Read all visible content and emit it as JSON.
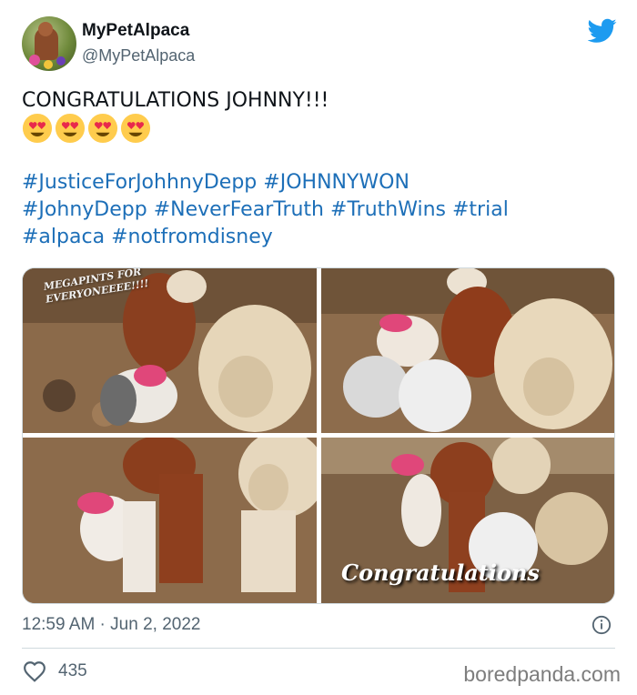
{
  "user": {
    "display_name": "MyPetAlpaca",
    "handle": "@MyPetAlpaca"
  },
  "tweet": {
    "text": "CONGRATULATIONS JOHNNY!!!",
    "emoji_count": 4,
    "hashtags": [
      "#JusticeForJohhnyDepp",
      "#JOHNNYWON",
      "#JohnyDepp",
      "#NeverFearTruth",
      "#TruthWins",
      "#trial",
      "#alpaca",
      "#notfromdisney"
    ],
    "photos": [
      {
        "caption": "MEGAPINTS FOR EVERYONEEEE!!!!"
      },
      {
        "caption": ""
      },
      {
        "caption": ""
      },
      {
        "caption": "Congratulations"
      }
    ],
    "timestamp": "12:59 AM · Jun 2, 2022",
    "likes": "435"
  },
  "icons": {
    "twitter_logo": "twitter-bird-icon",
    "info": "info-icon",
    "like": "heart-icon",
    "emoji": "smiling-face-with-heart-eyes"
  },
  "colors": {
    "hashtag": "#1d6fb8",
    "twitter_blue": "#1d9bf0",
    "secondary_text": "#536471"
  },
  "watermark": "boredpanda.com"
}
